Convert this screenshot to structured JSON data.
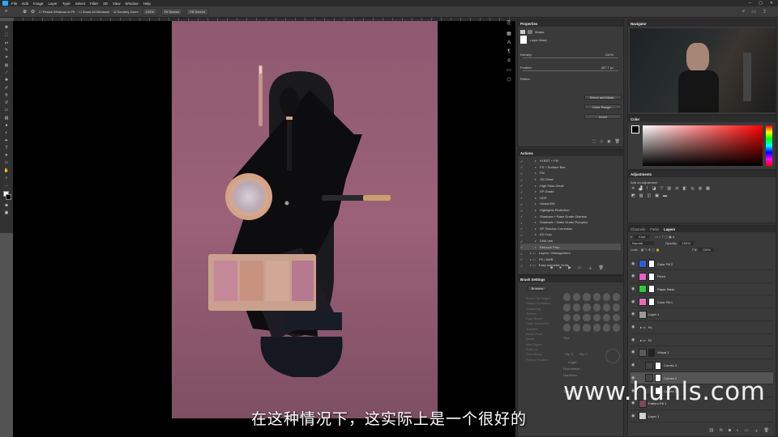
{
  "menubar": {
    "items": [
      "File",
      "Edit",
      "Image",
      "Layer",
      "Type",
      "Select",
      "Filter",
      "3D",
      "View",
      "Window",
      "Help"
    ]
  },
  "options": {
    "resize_windows": "Resize Windows to Fit",
    "zoom_all": "Zoom All Windows",
    "scrubby_zoom": "Scrubby Zoom",
    "zoom_pct": "100%",
    "fit_screen": "Fit Screen",
    "fill_screen": "Fill Screen"
  },
  "properties": {
    "title": "Properties",
    "masks_label": "Masks",
    "layer_mask": "Layer Mask",
    "density_label": "Density:",
    "density_value": "100%",
    "feather_label": "Feather:",
    "feather_value": "467.7 px",
    "refine_label": "Refine:",
    "select_mask": "Select and Mask...",
    "color_range": "Color Range...",
    "invert": "Invert"
  },
  "navigator": {
    "title": "Navigator"
  },
  "color": {
    "title": "Color"
  },
  "adjustments": {
    "title": "Adjustments",
    "subtitle": "Add an adjustment"
  },
  "actions": {
    "title": "Actions",
    "items": [
      "Hi BST + FM",
      "FS + Surface Blur",
      "FM",
      "1M Clean",
      "High Pass Small",
      "SP Grade",
      "HDR",
      "Vanza BW",
      "Highlights Reduction",
      "Shadows + Base Grade Distress",
      "Shadows + Base Grade Pumpkin",
      "SP Shadow Correction",
      "A3 Crop",
      "DNA Vari",
      "Retouch Prep",
      "Layers / Management",
      "PS / AWB",
      "Easy Isometric Grids"
    ]
  },
  "brush_settings": {
    "title": "Brush Settings",
    "brushes_btn": "Brushes",
    "items": [
      "Brush Tip Shape",
      "Shape Dynamics",
      "Scattering",
      "Texture",
      "Dual Brush",
      "Color Dynamics",
      "Transfer",
      "Brush Pose",
      "Noise",
      "Wet Edges",
      "Build-up",
      "Smoothing",
      "Protect Texture"
    ],
    "size_label": "Size",
    "flip_x": "Flip X",
    "flip_y": "Flip Y",
    "angle_label": "Angle:",
    "roundness_label": "Roundness:",
    "hardness_label": "Hardness",
    "spacing_label": "Spacing"
  },
  "layers": {
    "tabs": [
      "Channels",
      "Paths",
      "Layers"
    ],
    "kind_label": "Kind",
    "blend_mode": "Normal",
    "opacity_label": "Opacity:",
    "opacity_value": "100%",
    "lock_label": "Lock:",
    "fill_label": "Fill:",
    "fill_value": "100%",
    "items": [
      {
        "name": "Color Fill 2",
        "color": "#2f5fd6"
      },
      {
        "name": "Pinch",
        "color": "#e85fc7"
      },
      {
        "name": "Paper Mask",
        "color": "#2fc93a"
      },
      {
        "name": "Color Fill 1",
        "color": "#e06fb5"
      },
      {
        "name": "Layer 1",
        "color": "#9a9a9a"
      },
      {
        "name": "Fs",
        "color": "#6a6a6a"
      },
      {
        "name": "Fil",
        "color": "#6a6a6a"
      },
      {
        "name": "Virtual 2",
        "color": "#5a5a5a"
      },
      {
        "name": "Curves 3",
        "color": "#444"
      },
      {
        "name": "Curves 2",
        "color": "#444"
      },
      {
        "name": "Curves 1",
        "color": "#444"
      },
      {
        "name": "Pattern Fill 1",
        "color": "#7a4a5a"
      },
      {
        "name": "Layer 1",
        "color": "#cfcfcf"
      }
    ]
  },
  "subtitle": "在这种情况下，这实际上是一个很好的",
  "watermark": "www.hunls.com",
  "colors": {
    "canvas_bg": "#8e5a70",
    "accent": "#31a8ff"
  }
}
